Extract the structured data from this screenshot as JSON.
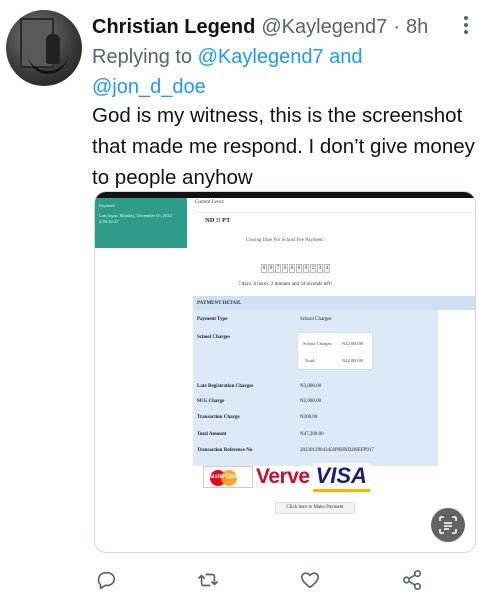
{
  "tweet": {
    "display_name": "Christian Legend",
    "handle": "@Kaylegend7",
    "separator": "·",
    "time": "8h",
    "replying_prefix": "Replying to",
    "replying_user1": "@Kaylegend7",
    "replying_and": "and",
    "replying_user2": "@jon_d_doe",
    "text": "God is my witness, this is the screenshot that made me respond. I don’t give money to people anyhow"
  },
  "media": {
    "sidebar_title": "Payment",
    "sidebar_login": "Last login: Monday, December 05, 2022 4:50:22:47",
    "current_level_label": "Current Level:",
    "current_level_value": "ND !! PT",
    "closing_text": "Closing Date For School Fee Payment:",
    "counter_digits": [
      "0",
      "0",
      "7",
      "0",
      "0",
      "6",
      "0",
      "2",
      "3",
      "4"
    ],
    "countdown_text": "7 days, 6 hours, 2 minutes and 34 seconds left!",
    "panel_title": "PAYMENT DETAIL",
    "rows": [
      {
        "label": "Payment Type",
        "value": "School Charges"
      },
      {
        "label": "School Charges",
        "value": ""
      },
      {
        "label": "Late Registration Charges",
        "value": "N3,000.00"
      },
      {
        "label": "SUG Charge",
        "value": "N2,000.00"
      },
      {
        "label": "Transaction Charge",
        "value": "N300.00"
      },
      {
        "label": "Total Amount",
        "value": "N47,300.00"
      },
      {
        "label": "Transaction Reference No",
        "value": "20220129043456P9HND28IEFP917"
      }
    ],
    "inner": {
      "school_charges_label": "School Charges:",
      "school_charges_value": "N42,000.00",
      "total_label": "Total:",
      "total_value": "N42,000.00"
    },
    "card_mastercard": "MasterCard",
    "card_verve": "Verve",
    "card_visa": "VISA",
    "pay_button": "Click here to Make Payment",
    "lens_icon": "google-lens-icon"
  },
  "actions": [
    "reply-icon",
    "retweet-icon",
    "like-icon",
    "share-icon"
  ],
  "colors": {
    "link": "#1d9bf0",
    "muted": "#536471",
    "text": "#0f1419",
    "sidebar": "#2f9c89"
  }
}
